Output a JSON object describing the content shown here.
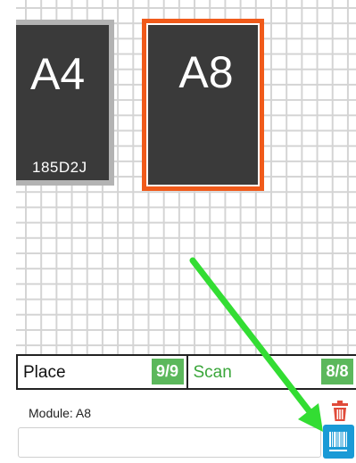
{
  "tiles": {
    "a4": {
      "label": "A4",
      "code": "185D2J"
    },
    "a8": {
      "label": "A8",
      "selected": true
    }
  },
  "status": {
    "place": {
      "label": "Place",
      "count": "9/9"
    },
    "scan": {
      "label": "Scan",
      "count": "8/8"
    }
  },
  "module": {
    "label": "Module: A8"
  },
  "input": {
    "value": "",
    "placeholder": ""
  },
  "icons": {
    "trash": "trash-icon",
    "barcode": "barcode-icon",
    "arrow": "arrow-annotation"
  },
  "colors": {
    "selected_border": "#f05a1a",
    "tile_bg": "#3a3a3a",
    "count_badge": "#5cb85c",
    "scan_text": "#3aa63a",
    "barcode_button": "#1a9ad6",
    "trash": "#e04b3a",
    "arrow": "#33dd33"
  }
}
